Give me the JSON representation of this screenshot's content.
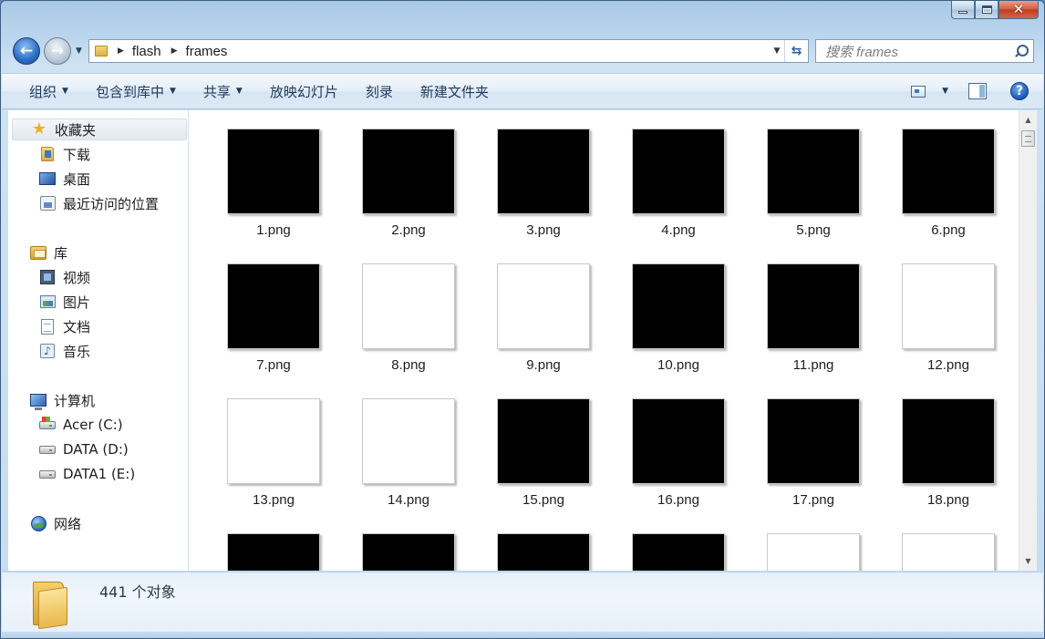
{
  "window": {
    "caption": {
      "minimize": "minimize",
      "maximize": "maximize",
      "close": "close"
    }
  },
  "address": {
    "crumbs": [
      "flash",
      "frames"
    ]
  },
  "search": {
    "placeholder": "搜索 frames"
  },
  "toolbar": {
    "organize": "组织",
    "include_in_library": "包含到库中",
    "share": "共享",
    "slideshow": "放映幻灯片",
    "burn": "刻录",
    "new_folder": "新建文件夹"
  },
  "sidebar": {
    "favorites": {
      "label": "收藏夹",
      "items": [
        {
          "label": "下载",
          "icon": "downloads-folder-icon"
        },
        {
          "label": "桌面",
          "icon": "desktop-icon"
        },
        {
          "label": "最近访问的位置",
          "icon": "recent-places-icon"
        }
      ]
    },
    "libraries": {
      "label": "库",
      "items": [
        {
          "label": "视频",
          "icon": "videos-icon"
        },
        {
          "label": "图片",
          "icon": "pictures-icon"
        },
        {
          "label": "文档",
          "icon": "documents-icon"
        },
        {
          "label": "音乐",
          "icon": "music-icon"
        }
      ]
    },
    "computer": {
      "label": "计算机",
      "items": [
        {
          "label": "Acer (C:)",
          "icon": "system-drive-icon"
        },
        {
          "label": "DATA (D:)",
          "icon": "drive-icon"
        },
        {
          "label": "DATA1 (E:)",
          "icon": "drive-icon"
        }
      ]
    },
    "network": {
      "label": "网络"
    }
  },
  "files": [
    {
      "name": "1.png",
      "color": "#000000"
    },
    {
      "name": "2.png",
      "color": "#000000"
    },
    {
      "name": "3.png",
      "color": "#000000"
    },
    {
      "name": "4.png",
      "color": "#000000"
    },
    {
      "name": "5.png",
      "color": "#000000"
    },
    {
      "name": "6.png",
      "color": "#000000"
    },
    {
      "name": "7.png",
      "color": "#000000"
    },
    {
      "name": "8.png",
      "color": "#ffffff"
    },
    {
      "name": "9.png",
      "color": "#ffffff"
    },
    {
      "name": "10.png",
      "color": "#000000"
    },
    {
      "name": "11.png",
      "color": "#000000"
    },
    {
      "name": "12.png",
      "color": "#ffffff"
    },
    {
      "name": "13.png",
      "color": "#ffffff"
    },
    {
      "name": "14.png",
      "color": "#ffffff"
    },
    {
      "name": "15.png",
      "color": "#000000"
    },
    {
      "name": "16.png",
      "color": "#000000"
    },
    {
      "name": "17.png",
      "color": "#000000"
    },
    {
      "name": "18.png",
      "color": "#000000"
    },
    {
      "name": "",
      "color": "#000000"
    },
    {
      "name": "",
      "color": "#000000"
    },
    {
      "name": "",
      "color": "#000000"
    },
    {
      "name": "",
      "color": "#000000"
    },
    {
      "name": "",
      "color": "#ffffff"
    },
    {
      "name": "",
      "color": "#ffffff"
    }
  ],
  "details": {
    "count_text": "441 个对象"
  }
}
